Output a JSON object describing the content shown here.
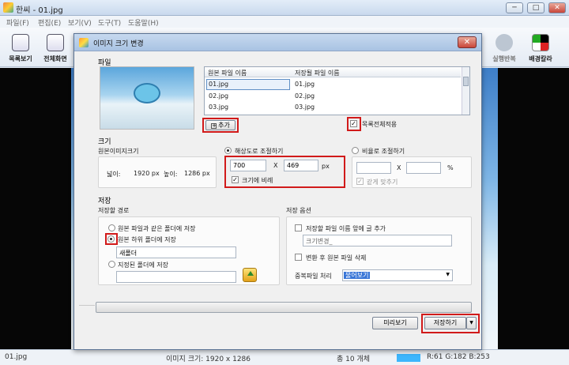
{
  "app": {
    "title": "한씨 - 01.jpg",
    "menu": [
      "파일(F)",
      "편집(E)",
      "보기(V)",
      "도구(T)",
      "도움말(H)"
    ],
    "toolbar_left": [
      "목록보기",
      "전체화면"
    ],
    "toolbar_right": [
      "실행반복",
      "배경칼라"
    ],
    "window_buttons": [
      "─",
      "□",
      "✕"
    ]
  },
  "status": {
    "file": "01.jpg",
    "size": "이미지 크기: 1920 x 1286",
    "count": "총 10 개체",
    "rgb": "R:61 G:182 B:253"
  },
  "dialog": {
    "title": "이미지 크기 변경",
    "file_section": "파일",
    "columns": [
      "원본 파일 이름",
      "저장될 파일 이름"
    ],
    "files": [
      {
        "src": "01.jpg",
        "dst": "01.jpg"
      },
      {
        "src": "02.jpg",
        "dst": "02.jpg"
      },
      {
        "src": "03.jpg",
        "dst": "03.jpg"
      }
    ],
    "add_button": "추가",
    "apply_all": "목록전체적용",
    "size_section": "크기",
    "original_size_label": "원본이미지크기",
    "width_label": "넓이:",
    "width_value": "1920 px",
    "height_label": "높이:",
    "height_value": "1286 px",
    "by_resolution": "해상도로 조절하기",
    "res_width": "700",
    "res_height": "469",
    "x": "X",
    "px": "px",
    "keep_ratio": "크기에 비례",
    "by_ratio": "비율로 조절하기",
    "ratio_x": "X",
    "percent": "%",
    "same_ratio": "같게 맞추기",
    "save_section": "저장",
    "save_path_label": "저장할 경로",
    "opt_same_folder": "원본 파일과 같은 폴더에 저장",
    "opt_sub_folder": "원본 하위 폴더에 저장",
    "sub_folder_value": "새폴더",
    "opt_specified": "지정된 폴더에 저장",
    "specified_value": "",
    "save_options_label": "저장 옵션",
    "add_prefix": "저장할 파일 이름 앞에 글 추가",
    "prefix_value": "크기변경_",
    "delete_original": "변환 후 원본 파일 삭제",
    "duplicate_label": "중복파일 처리",
    "duplicate_value": "물어보기",
    "preview_button": "미리보기",
    "save_button": "저장하기",
    "close": "✕",
    "dropdown_arrow": "▼",
    "check": "✓",
    "folder_icon": "folder-up-icon"
  }
}
